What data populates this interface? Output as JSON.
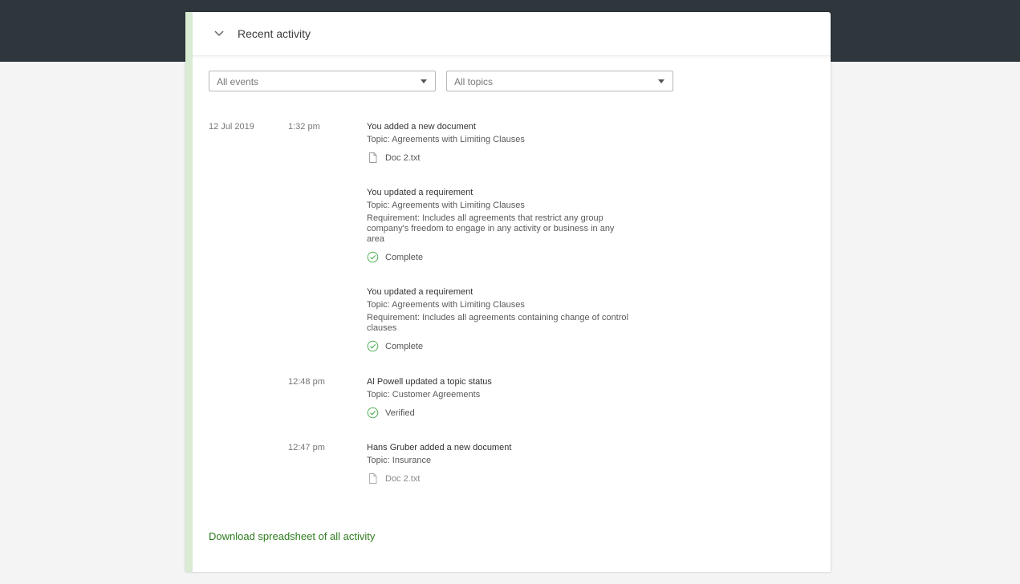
{
  "panel": {
    "title": "Recent activity"
  },
  "filters": {
    "events": "All events",
    "topics": "All topics"
  },
  "activity": {
    "date": "12 Jul 2019",
    "entries": [
      {
        "time": "1:32 pm",
        "heading": "You added a new document",
        "topic": "Topic: Agreements with Limiting Clauses",
        "extra": "Doc 2.txt",
        "extra_icon": "document-icon"
      },
      {
        "heading": "You updated a requirement",
        "topic": "Topic: Agreements with Limiting Clauses",
        "requirement": "Requirement: Includes all agreements that restrict any group company's freedom to engage in any activity or business in any area",
        "extra": "Complete",
        "extra_icon": "check-circle-icon"
      },
      {
        "heading": "You updated a requirement",
        "topic": "Topic: Agreements with Limiting Clauses",
        "requirement": "Requirement: Includes all agreements containing change of control clauses",
        "extra": "Complete",
        "extra_icon": "check-circle-icon"
      },
      {
        "time": "12:48 pm",
        "heading": "Al Powell updated a topic status",
        "topic": "Topic: Customer Agreements",
        "extra": "Verified",
        "extra_icon": "check-circle-icon"
      },
      {
        "time": "12:47 pm",
        "heading": "Hans Gruber added a new document",
        "topic": "Topic: Insurance",
        "extra": "Doc 2.txt",
        "extra_icon": "document-icon"
      }
    ]
  },
  "download_link": "Download spreadsheet of all activity",
  "colors": {
    "topbar": "#2f363c",
    "accent": "#d9ecd3",
    "link": "#2e7d1f",
    "check": "#4caf50"
  }
}
